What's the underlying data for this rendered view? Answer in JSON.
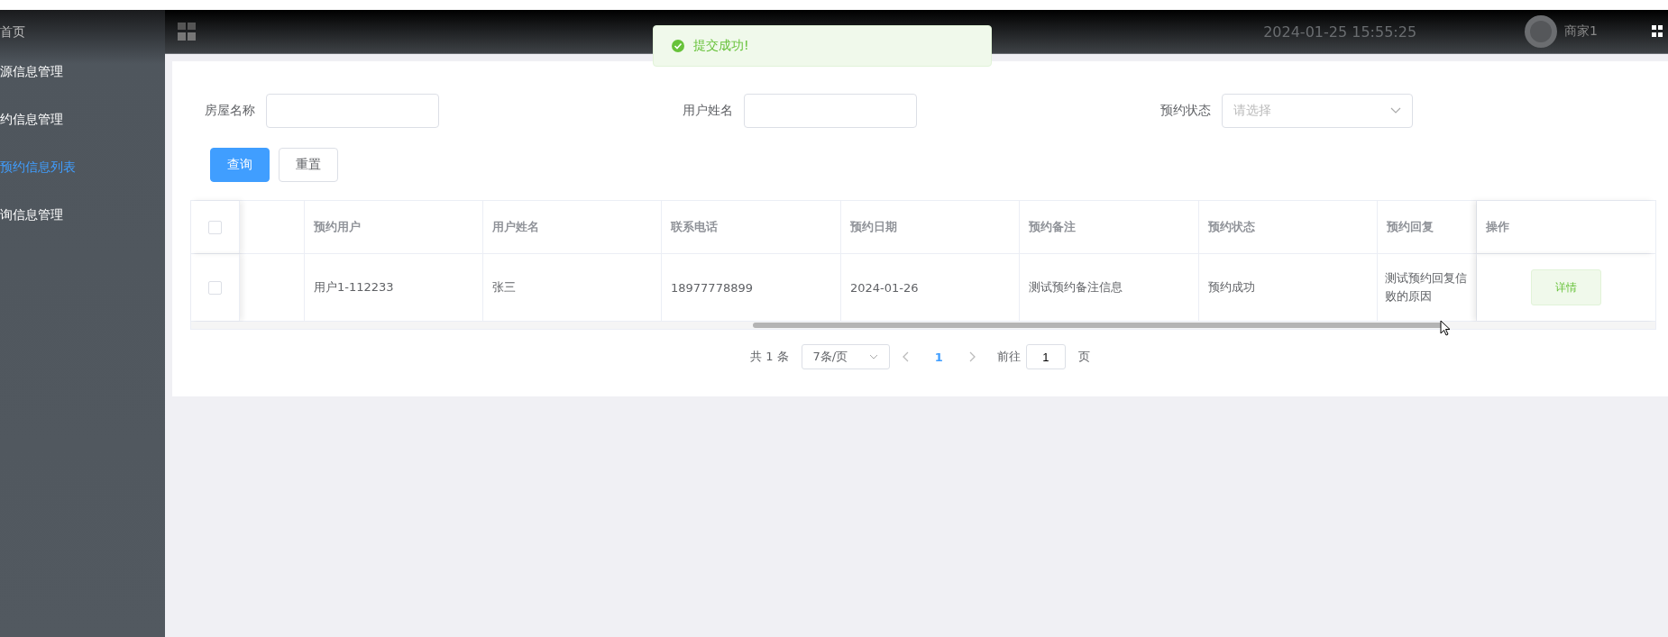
{
  "sidebar": {
    "items": [
      {
        "label": "首页",
        "selected": false
      },
      {
        "label": "源信息管理",
        "selected": false
      },
      {
        "label": "约信息管理",
        "selected": false
      },
      {
        "label": "预约信息列表",
        "selected": true
      },
      {
        "label": "询信息管理",
        "selected": false
      }
    ]
  },
  "header": {
    "datetime": "2024-01-25 15:55:25",
    "user": "商家1"
  },
  "toast": {
    "message": "提交成功!"
  },
  "filters": [
    {
      "kind": "text",
      "label": "房屋名称"
    },
    {
      "kind": "text",
      "label": "用户姓名"
    },
    {
      "kind": "select",
      "label": "预约状态",
      "placeholder": "请选择"
    }
  ],
  "buttons": [
    {
      "label": "查询",
      "kind": "primary"
    },
    {
      "label": "重置",
      "kind": "default"
    }
  ],
  "table": {
    "columns": [
      "",
      "预约用户",
      "用户姓名",
      "联系电话",
      "预约日期",
      "预约备注",
      "预约状态",
      "预约回复"
    ],
    "action_column": "操作",
    "select_all": false,
    "rows": [
      {
        "checked": false,
        "cells": [
          "",
          "用户1-112233",
          "张三",
          "18977778899",
          "2024-01-26",
          "测试预约备注信息",
          "预约成功",
          "测试预约回复信败的原因"
        ],
        "action": "详情"
      }
    ]
  },
  "pagination": {
    "total": "共 1 条",
    "page_size": "7条/页",
    "pages": [
      {
        "label": "1",
        "selected": true
      }
    ],
    "goto_label": "前往",
    "goto_value": "1",
    "goto_suffix": "页"
  }
}
